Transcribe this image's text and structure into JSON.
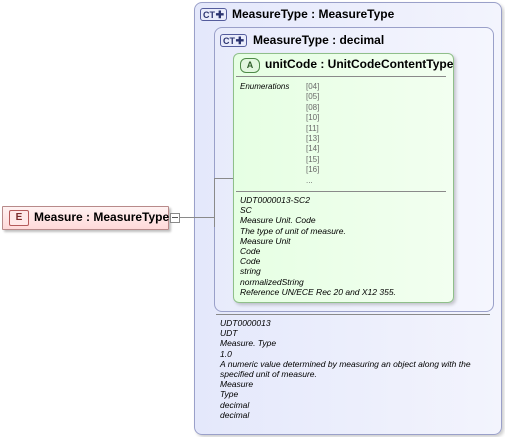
{
  "element": {
    "badge": "E",
    "title": "Measure : MeasureType"
  },
  "outer_type": {
    "badge": "CT",
    "title": "MeasureType : MeasureType",
    "documentation": [
      "UDT0000013",
      "UDT",
      "Measure. Type",
      "1.0",
      "A numeric value determined by measuring an object along with the specified unit of measure.",
      "Measure",
      "Type",
      "decimal",
      "decimal"
    ]
  },
  "inner_type": {
    "badge": "CT",
    "title": "MeasureType : decimal"
  },
  "attribute": {
    "badge": "A",
    "title": "unitCode : UnitCodeContentType",
    "enumerations_label": "Enumerations",
    "enumerations": [
      "[04]",
      "[05]",
      "[08]",
      "[10]",
      "[11]",
      "[13]",
      "[14]",
      "[15]",
      "[16]",
      "..."
    ],
    "documentation": [
      "UDT0000013-SC2",
      "SC",
      "Measure Unit. Code",
      "The type of unit of measure.",
      "Measure Unit",
      "Code",
      "Code",
      "string",
      "normalizedString",
      "Reference UN/ECE Rec 20 and X12 355."
    ]
  }
}
